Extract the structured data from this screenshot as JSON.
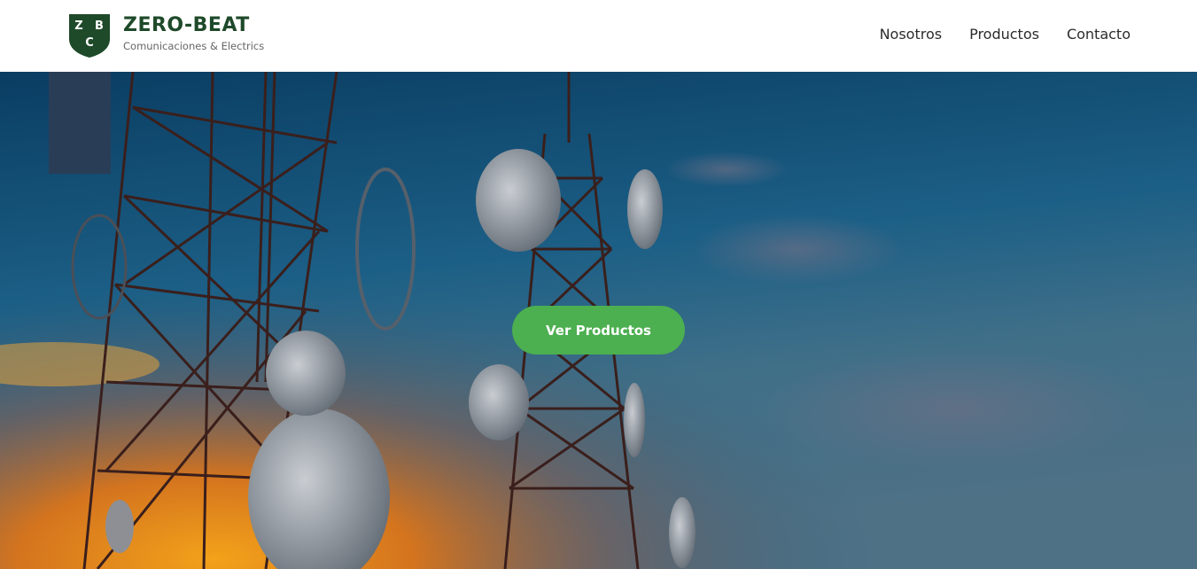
{
  "brand": {
    "logo_letters": [
      "Z",
      "B",
      "C"
    ],
    "title": "ZERO-BEAT",
    "subtitle": "Comunicaciones & Electrics",
    "color": "#1f4a2a"
  },
  "nav": {
    "items": [
      {
        "label": "Nosotros"
      },
      {
        "label": "Productos"
      },
      {
        "label": "Contacto"
      }
    ]
  },
  "hero": {
    "cta_label": "Ver Productos",
    "cta_color": "#4caf50",
    "image_subject": "telecom-towers-sunset"
  }
}
